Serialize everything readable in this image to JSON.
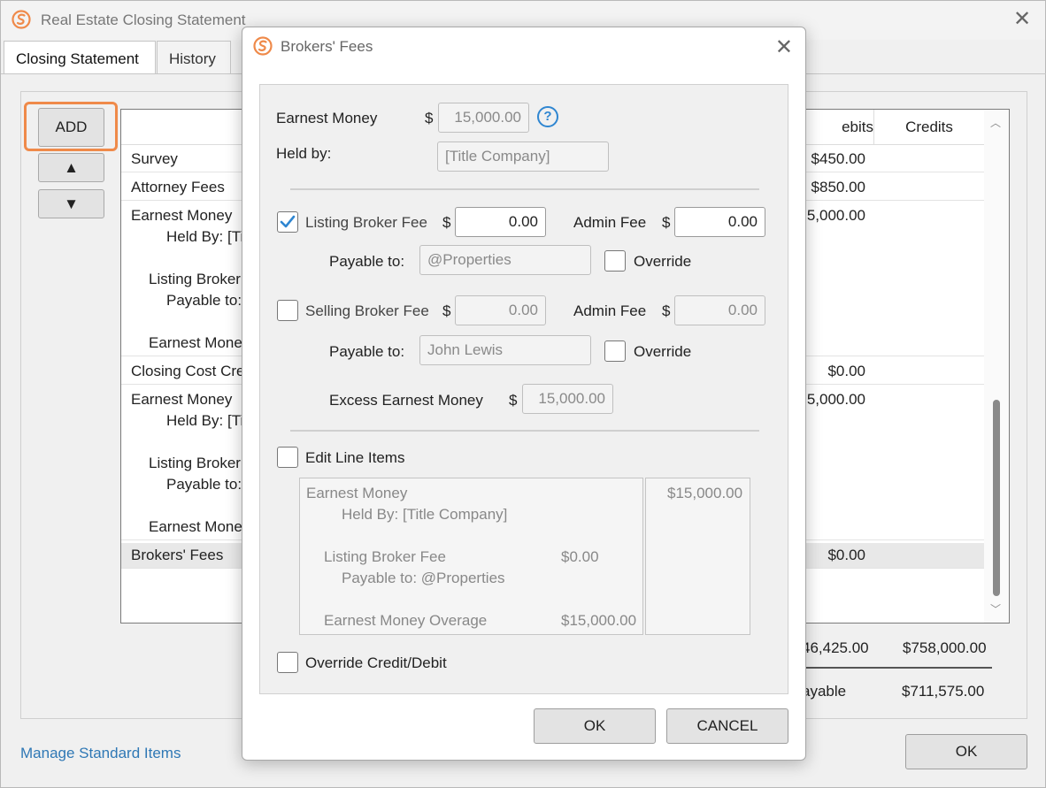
{
  "window": {
    "title": "Real Estate Closing Statement",
    "close_glyph": "✕"
  },
  "tabs": [
    {
      "label": "Closing Statement",
      "active": true
    },
    {
      "label": "History",
      "active": false
    }
  ],
  "side_buttons": {
    "add_label": "ADD",
    "up_glyph": "▲",
    "down_glyph": "▼"
  },
  "list": {
    "columns": {
      "debits": "ebits",
      "credits": "Credits"
    },
    "rows": [
      {
        "lines": [
          "Survey"
        ],
        "debit": "$450.00"
      },
      {
        "lines": [
          "Attorney Fees"
        ],
        "debit": "$850.00"
      },
      {
        "lines": [
          "Earnest Money",
          "Held By: [Ti",
          "Listing Broker",
          "Payable to:",
          "Earnest Mone"
        ],
        "debit": "5,000.00"
      },
      {
        "lines": [
          "Closing Cost Cre"
        ],
        "debit": "$0.00"
      },
      {
        "lines": [
          "Earnest Money",
          "Held By: [Ti",
          "Listing Broker",
          "Payable to:",
          "Earnest Mone"
        ],
        "debit": "5,000.00"
      },
      {
        "lines": [
          "Brokers' Fees"
        ],
        "debit": "$0.00"
      }
    ]
  },
  "totals": {
    "debits": "46,425.00",
    "credits": "$758,000.00",
    "payable_label": "ayable",
    "payable_value": "$711,575.00"
  },
  "footer": {
    "manage_link": "Manage Standard Items",
    "ok_label": "OK"
  },
  "dialog": {
    "title": "Brokers' Fees",
    "close_glyph": "✕",
    "earnest_money": {
      "label": "Earnest Money",
      "currency": "$",
      "value": "15,000.00",
      "help": "?"
    },
    "held_by": {
      "label": "Held by:",
      "value": "[Title Company]"
    },
    "listing": {
      "checked": true,
      "label": "Listing Broker Fee",
      "currency": "$",
      "value": "0.00",
      "admin_label": "Admin Fee",
      "admin_currency": "$",
      "admin_value": "0.00",
      "payable_label": "Payable to:",
      "payable_value": "@Properties",
      "override_label": "Override"
    },
    "selling": {
      "checked": false,
      "label": "Selling Broker Fee",
      "currency": "$",
      "value": "0.00",
      "admin_label": "Admin Fee",
      "admin_currency": "$",
      "admin_value": "0.00",
      "payable_label": "Payable to:",
      "payable_value": "John Lewis",
      "override_label": "Override"
    },
    "excess": {
      "label": "Excess Earnest Money",
      "currency": "$",
      "value": "15,000.00"
    },
    "edit_line_items": {
      "label": "Edit Line Items",
      "checked": false
    },
    "line_items": {
      "l1": "Earnest Money",
      "l2": "Held By: [Title Company]",
      "l3": "Listing Broker Fee",
      "l3_amt": "$0.00",
      "l4": "Payable to: @Properties",
      "l5": "Earnest Money Overage",
      "l5_amt": "$15,000.00",
      "total": "$15,000.00"
    },
    "override_credit_debit": {
      "label": "Override Credit/Debit",
      "checked": false
    },
    "ok_label": "OK",
    "cancel_label": "CANCEL"
  },
  "colors": {
    "accent_orange": "#ef8a4a",
    "link_blue": "#2f78b5",
    "check_blue": "#2f86d1"
  },
  "icons": {
    "app": "app-logo-icon",
    "close": "close-icon",
    "help": "help-icon",
    "check": "checkmark-icon"
  }
}
